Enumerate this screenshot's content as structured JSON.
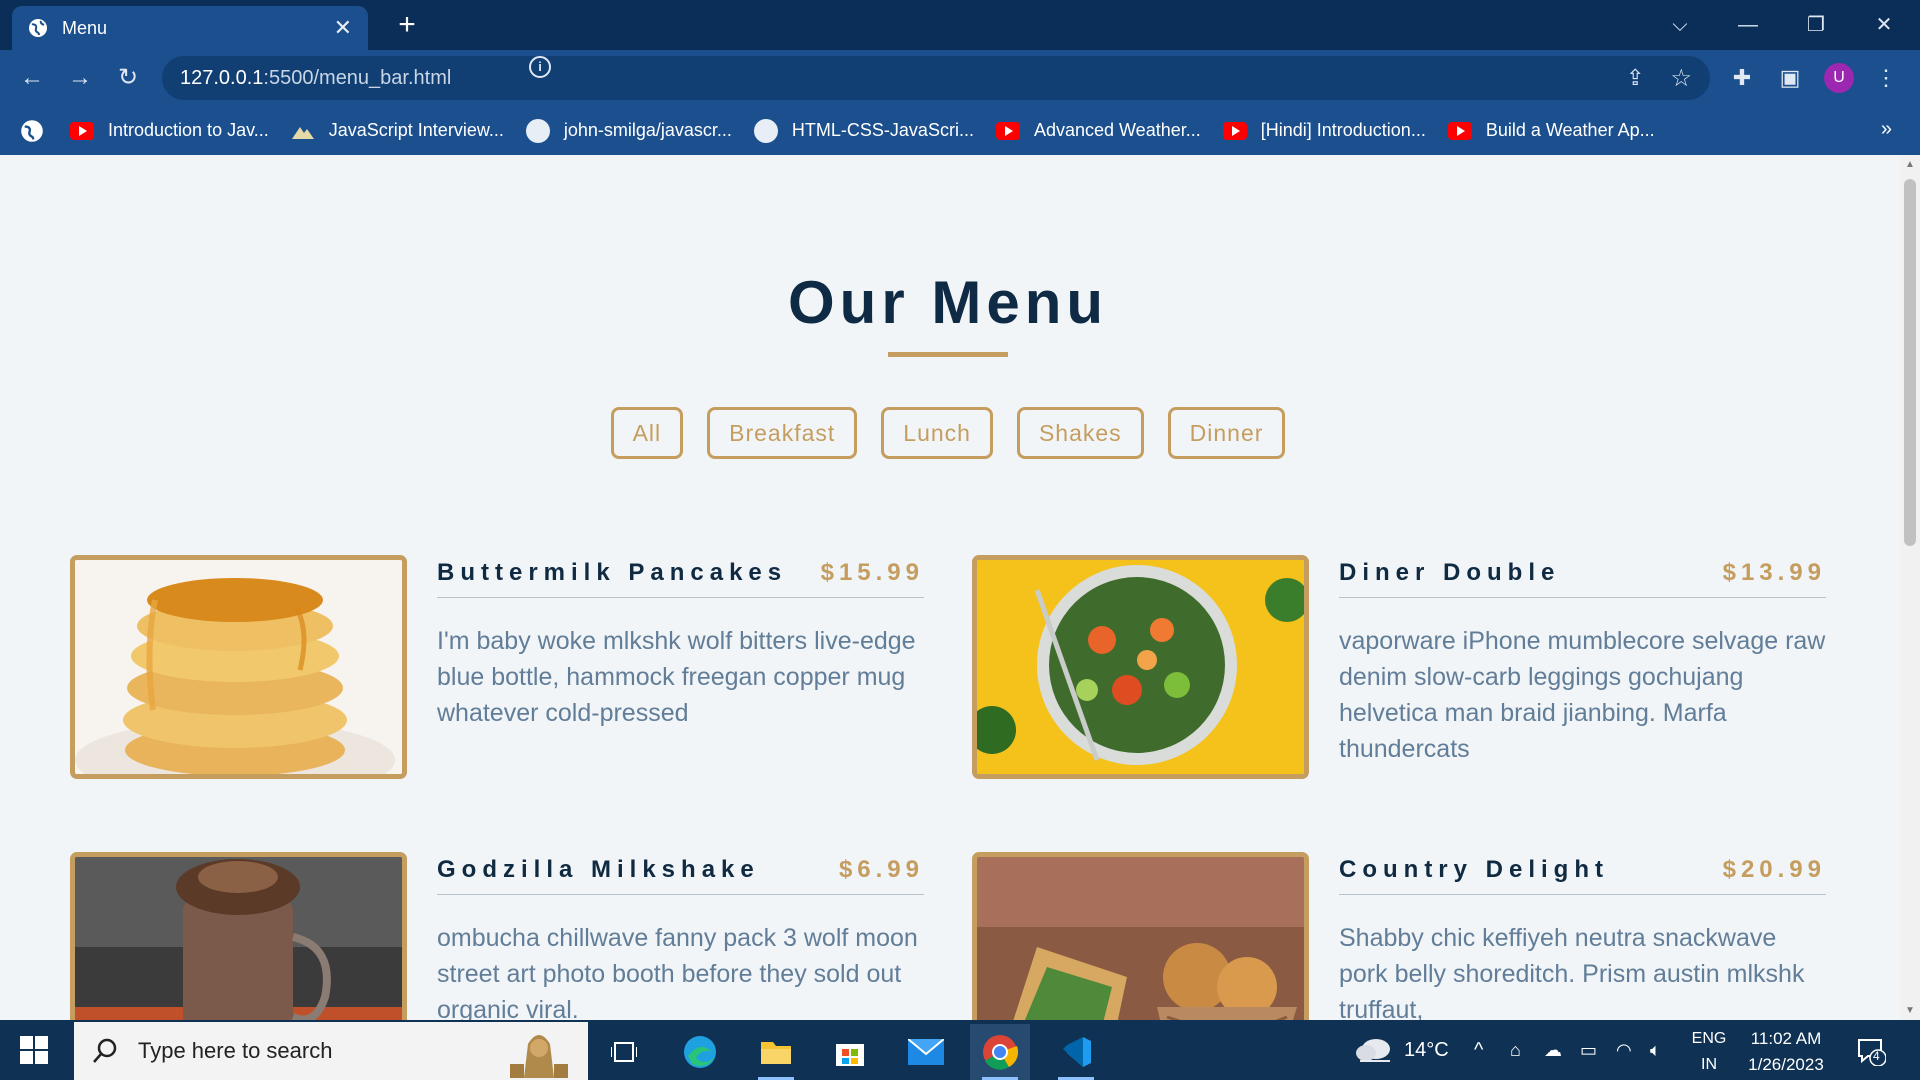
{
  "browser": {
    "tab_title": "Menu",
    "url_host": "127.0.0.1",
    "url_path": ":5500/menu_bar.html",
    "bookmarks": [
      {
        "label": "Introduction to Jav...",
        "icon": "youtube-icon"
      },
      {
        "label": "JavaScript Interview...",
        "icon": "mountain-icon"
      },
      {
        "label": "john-smilga/javascr...",
        "icon": "github-icon"
      },
      {
        "label": "HTML-CSS-JavaScri...",
        "icon": "github-icon"
      },
      {
        "label": "Advanced Weather...",
        "icon": "youtube-icon"
      },
      {
        "label": "[Hindi] Introduction...",
        "icon": "youtube-icon"
      },
      {
        "label": "Build a Weather Ap...",
        "icon": "youtube-icon"
      }
    ],
    "profile_initial": "U",
    "more_bookmarks": "»"
  },
  "page": {
    "title": "Our Menu",
    "filters": [
      "All",
      "Breakfast",
      "Lunch",
      "Shakes",
      "Dinner"
    ],
    "items": [
      {
        "name": "Buttermilk Pancakes",
        "price": "$15.99",
        "desc": "I'm baby woke mlkshk wolf bitters live-edge blue bottle, hammock freegan copper mug whatever cold-pressed"
      },
      {
        "name": "Diner Double",
        "price": "$13.99",
        "desc": "vaporware iPhone mumblecore selvage raw denim slow-carb leggings gochujang helvetica man braid jianbing. Marfa thundercats"
      },
      {
        "name": "Godzilla Milkshake",
        "price": "$6.99",
        "desc": "ombucha chillwave fanny pack 3 wolf moon street art photo booth before they sold out organic viral."
      },
      {
        "name": "Country Delight",
        "price": "$20.99",
        "desc": "Shabby chic keffiyeh neutra snackwave pork belly shoreditch. Prism austin mlkshk truffaut,"
      }
    ]
  },
  "taskbar": {
    "search_placeholder": "Type here to search",
    "weather": "14°C",
    "lang_line1": "ENG",
    "lang_line2": "IN",
    "time": "11:02 AM",
    "date": "1/26/2023",
    "notification_count": "4"
  },
  "colors": {
    "accent": "#c59d5f",
    "heading": "#102a42",
    "text": "#617d98",
    "background": "#f1f5f8"
  }
}
